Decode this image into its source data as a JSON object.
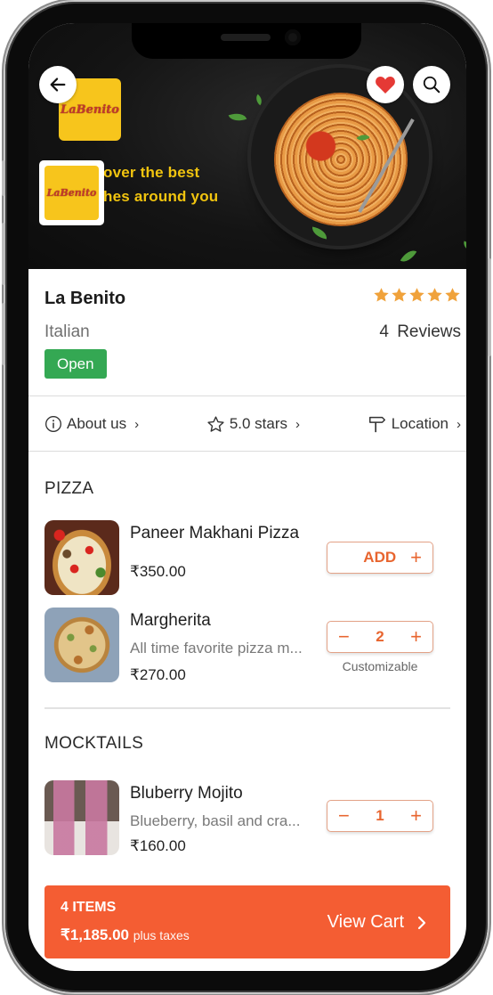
{
  "banner": {
    "tagline_line1": "over the best",
    "tagline_line2": "hes around you",
    "logo_text": "LaBenito"
  },
  "restaurant": {
    "name": "La Benito",
    "cuisine": "Italian",
    "status": "Open",
    "rating_stars": 5,
    "reviews_count": "4",
    "reviews_label": "Reviews",
    "status_color": "#34a853",
    "star_color": "#f0a23b"
  },
  "quick_links": [
    {
      "label": "About us",
      "icon": "info-icon"
    },
    {
      "label": "5.0 stars",
      "icon": "star-outline-icon"
    },
    {
      "label": "Location",
      "icon": "signpost-icon"
    }
  ],
  "menu": {
    "sections": [
      {
        "title": "PIZZA",
        "items": [
          {
            "name": "Paneer Makhani Pizza",
            "description": "",
            "price": "₹350.00",
            "action": "ADD",
            "quantity": null,
            "note": ""
          },
          {
            "name": "Margherita",
            "description": "All time favorite pizza m...",
            "price": "₹270.00",
            "action": "stepper",
            "quantity": "2",
            "note": "Customizable"
          }
        ]
      },
      {
        "title": "MOCKTAILS",
        "items": [
          {
            "name": "Bluberry Mojito",
            "description": "Blueberry, basil and cra...",
            "price": "₹160.00",
            "action": "stepper",
            "quantity": "1",
            "note": ""
          }
        ]
      }
    ]
  },
  "cart": {
    "items_label": "4 ITEMS",
    "total": "₹1,185.00",
    "taxes_label": "plus taxes",
    "view_label": "View Cart",
    "color": "#f45d33"
  },
  "accent_color": "#e8652f"
}
